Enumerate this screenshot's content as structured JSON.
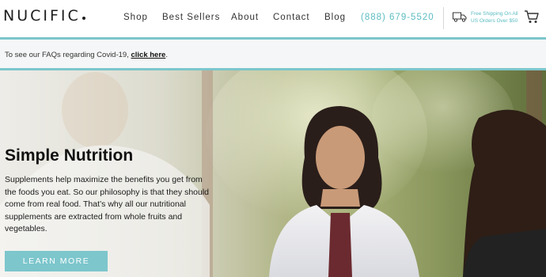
{
  "header": {
    "logo": "NUCIFIC",
    "nav": {
      "shop": "Shop",
      "best_sellers": "Best Sellers",
      "about": "About",
      "contact": "Contact",
      "blog": "Blog",
      "phone": "(888) 679-5520"
    },
    "shipping_line1": "Free Shipping On All",
    "shipping_line2": "US Orders Over $50",
    "icons": {
      "shipping": "truck-icon",
      "cart": "cart-icon"
    },
    "accent_color": "#7cc6cc"
  },
  "notice": {
    "text": "To see our FAQs regarding Covid-19, ",
    "link": "click here",
    "suffix": "."
  },
  "hero": {
    "title": "Simple Nutrition",
    "body": "Supplements help maximize the benefits you get from the foods you eat. So our philosophy is that they should come from real food. That’s why all our nutritional supplements are extracted from whole fruits and vegetables.",
    "button": "LEARN MORE"
  }
}
